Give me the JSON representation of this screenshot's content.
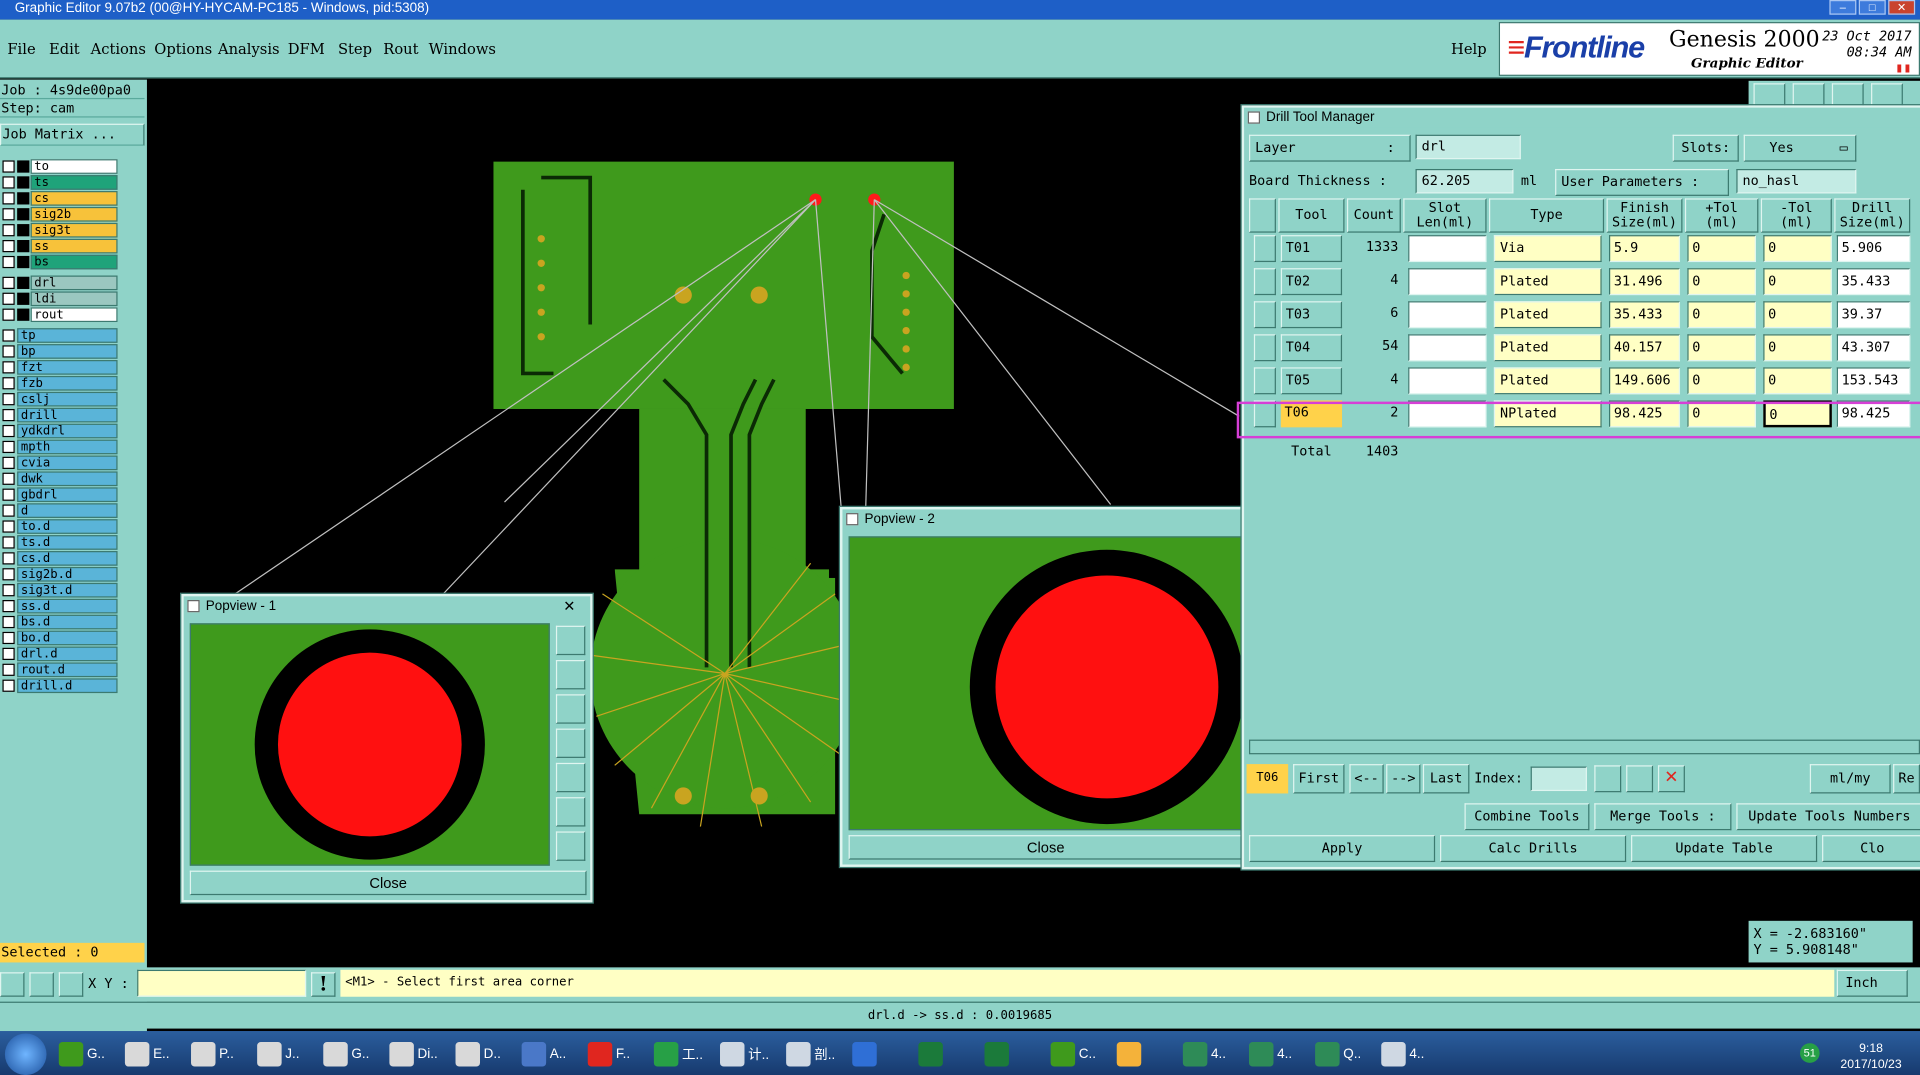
{
  "window_title": "Graphic Editor 9.07b2 (00@HY-HYCAM-PC185 - Windows, pid:5308)",
  "menu": [
    "File",
    "Edit",
    "Actions",
    "Options",
    "Analysis",
    "DFM",
    "Step",
    "Rout",
    "Windows"
  ],
  "help": "Help",
  "logo": {
    "brand": "Frontline",
    "product": "Genesis 2000",
    "subtitle": "Graphic Editor",
    "date": "23 Oct 2017",
    "time": "08:34 AM"
  },
  "left": {
    "job": "Job : 4s9de00pa0",
    "step": "Step: cam",
    "job_matrix": "Job Matrix ...",
    "selected": "Selected : 0",
    "board_layers": [
      {
        "name": "to",
        "color": "#ffffff"
      },
      {
        "name": "ts",
        "color": "#1fa37a"
      },
      {
        "name": "cs",
        "color": "#f7c23a"
      },
      {
        "name": "sig2b",
        "color": "#f7c23a"
      },
      {
        "name": "sig3t",
        "color": "#f7c23a"
      },
      {
        "name": "ss",
        "color": "#f7c23a"
      },
      {
        "name": "bs",
        "color": "#1fa37a"
      }
    ],
    "drill_layers": [
      {
        "name": "drl",
        "color": "#9bc7c0"
      },
      {
        "name": "ldi",
        "color": "#9bc7c0"
      },
      {
        "name": "rout",
        "color": "#ffffff"
      }
    ],
    "misc_layers": [
      "tp",
      "bp",
      "fzt",
      "fzb",
      "cslj",
      "drill",
      "ydkdrl",
      "mpth",
      "cvia",
      "dwk",
      "gbdrl",
      "d",
      "to.d",
      "ts.d",
      "cs.d",
      "sig2b.d",
      "sig3t.d",
      "ss.d",
      "bs.d",
      "bo.d",
      "drl.d",
      "rout.d",
      "drill.d"
    ]
  },
  "popview1": {
    "title": "Popview - 1",
    "close": "Close"
  },
  "popview2": {
    "title": "Popview - 2",
    "close": "Close"
  },
  "dtm": {
    "title": "Drill Tool Manager",
    "layer_label": "Layer",
    "layer_sep": ":",
    "layer_value": "drl",
    "slots_label": "Slots:",
    "slots_value": "Yes",
    "thickness_label": "Board Thickness :",
    "thickness_value": "62.205",
    "thickness_unit": "ml",
    "user_params_label": "User Parameters :",
    "user_params_value": "no_hasl",
    "columns": [
      "Tool",
      "Count",
      "Slot Len(ml)",
      "Type",
      "Finish Size(ml)",
      "+Tol (ml)",
      "-Tol (ml)",
      "Drill Size(ml)"
    ],
    "rows": [
      {
        "tool": "T01",
        "count": "1333",
        "type": "Via",
        "finish": "5.9",
        "ptol": "0",
        "ntol": "0",
        "drill": "5.906"
      },
      {
        "tool": "T02",
        "count": "4",
        "type": "Plated",
        "finish": "31.496",
        "ptol": "0",
        "ntol": "0",
        "drill": "35.433"
      },
      {
        "tool": "T03",
        "count": "6",
        "type": "Plated",
        "finish": "35.433",
        "ptol": "0",
        "ntol": "0",
        "drill": "39.37"
      },
      {
        "tool": "T04",
        "count": "54",
        "type": "Plated",
        "finish": "40.157",
        "ptol": "0",
        "ntol": "0",
        "drill": "43.307"
      },
      {
        "tool": "T05",
        "count": "4",
        "type": "Plated",
        "finish": "149.606",
        "ptol": "0",
        "ntol": "0",
        "drill": "153.543"
      },
      {
        "tool": "T06",
        "count": "2",
        "type": "NPlated",
        "finish": "98.425",
        "ptol": "0",
        "ntol": "0",
        "drill": "98.425"
      }
    ],
    "total_label": "Total",
    "total_value": "1403",
    "nav": {
      "current": "T06",
      "first": "First",
      "prev": "<--",
      "next": "-->",
      "last": "Last",
      "index_label": "Index:",
      "units": "ml/my",
      "reset": "Re"
    },
    "actions1": [
      "Combine Tools",
      "Merge Tools :",
      "Update Tools Numbers"
    ],
    "actions2": [
      "Apply",
      "Calc Drills",
      "Update Table",
      "Clo"
    ]
  },
  "coords": {
    "x": "X = -2.683160\"",
    "y": "Y = 5.908148\""
  },
  "cmd": {
    "xy_label": "X Y :",
    "prompt": "<M1> - Select first area corner",
    "units": "Inch"
  },
  "status": "drl.d -> ss.d : 0.0019685",
  "taskbar": {
    "items": [
      "G..",
      "E..",
      "P..",
      "J..",
      "G..",
      "Di..",
      "D..",
      "A..",
      "F..",
      "工..",
      "计..",
      "剖..",
      "",
      "",
      "",
      "C..",
      "",
      "4..",
      "4..",
      "Q..",
      "4.."
    ],
    "clock_time": "9:18",
    "clock_date": "2017/10/23",
    "tray_badge": "51"
  }
}
